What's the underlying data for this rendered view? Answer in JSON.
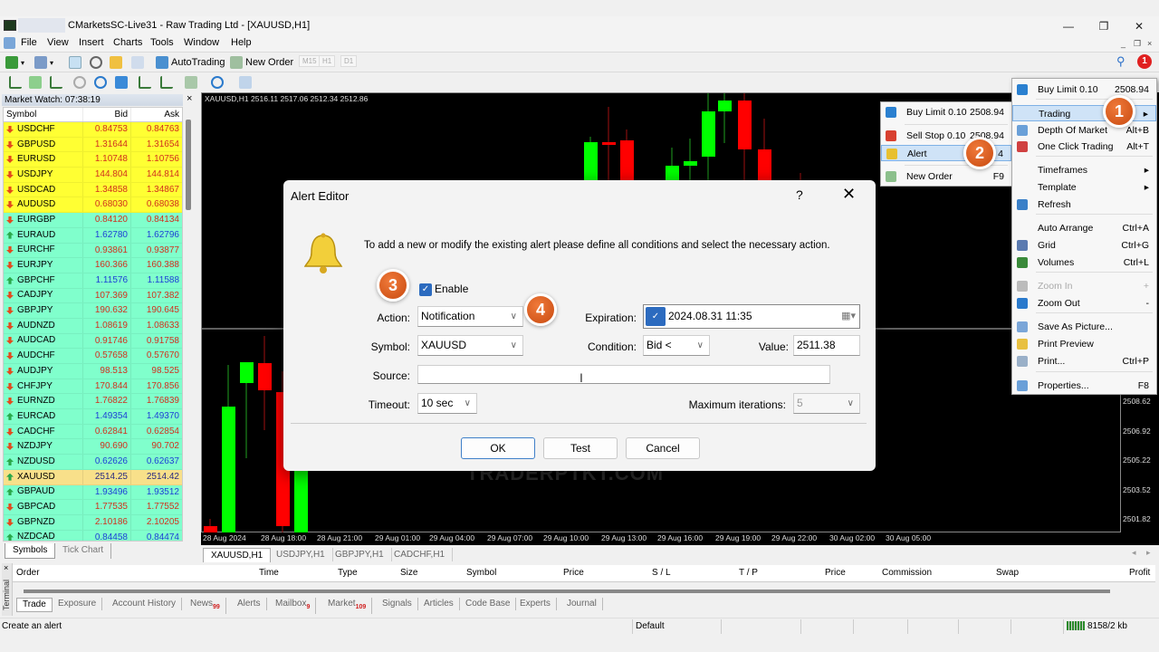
{
  "window": {
    "title": "CMarketsSC-Live31 - Raw Trading Ltd - [XAUUSD,H1]",
    "controls": {
      "minimize": "—",
      "maximize": "❐",
      "close": "✕"
    }
  },
  "menubar": {
    "items": [
      "File",
      "View",
      "Insert",
      "Charts",
      "Tools",
      "Window",
      "Help"
    ],
    "mdi": {
      "minimize": "_",
      "restore": "❐",
      "close": "×"
    }
  },
  "toolbar1": {
    "autotrading_label": "AutoTrading",
    "new_order_label": "New Order",
    "timeframes": [
      "M15",
      "H1",
      "D1"
    ],
    "notification_count": "1"
  },
  "market_watch": {
    "title": "Market Watch: 07:38:19",
    "close": "×",
    "columns": [
      "Symbol",
      "Bid",
      "Ask"
    ],
    "rows": [
      {
        "symbol": "USDCHF",
        "bid": "0.84753",
        "ask": "0.84763",
        "dir": "down",
        "bg": "yellow"
      },
      {
        "symbol": "GBPUSD",
        "bid": "1.31644",
        "ask": "1.31654",
        "dir": "down",
        "bg": "yellow"
      },
      {
        "symbol": "EURUSD",
        "bid": "1.10748",
        "ask": "1.10756",
        "dir": "down",
        "bg": "yellow"
      },
      {
        "symbol": "USDJPY",
        "bid": "144.804",
        "ask": "144.814",
        "dir": "down",
        "bg": "yellow"
      },
      {
        "symbol": "USDCAD",
        "bid": "1.34858",
        "ask": "1.34867",
        "dir": "down",
        "bg": "yellow"
      },
      {
        "symbol": "AUDUSD",
        "bid": "0.68030",
        "ask": "0.68038",
        "dir": "down",
        "bg": "yellow"
      },
      {
        "symbol": "EURGBP",
        "bid": "0.84120",
        "ask": "0.84134",
        "dir": "down",
        "bg": "teal"
      },
      {
        "symbol": "EURAUD",
        "bid": "1.62780",
        "ask": "1.62796",
        "dir": "up",
        "bg": "teal"
      },
      {
        "symbol": "EURCHF",
        "bid": "0.93861",
        "ask": "0.93877",
        "dir": "down",
        "bg": "teal"
      },
      {
        "symbol": "EURJPY",
        "bid": "160.366",
        "ask": "160.388",
        "dir": "down",
        "bg": "teal"
      },
      {
        "symbol": "GBPCHF",
        "bid": "1.11576",
        "ask": "1.11588",
        "dir": "up",
        "bg": "teal"
      },
      {
        "symbol": "CADJPY",
        "bid": "107.369",
        "ask": "107.382",
        "dir": "down",
        "bg": "teal"
      },
      {
        "symbol": "GBPJPY",
        "bid": "190.632",
        "ask": "190.645",
        "dir": "down",
        "bg": "teal"
      },
      {
        "symbol": "AUDNZD",
        "bid": "1.08619",
        "ask": "1.08633",
        "dir": "down",
        "bg": "teal"
      },
      {
        "symbol": "AUDCAD",
        "bid": "0.91746",
        "ask": "0.91758",
        "dir": "down",
        "bg": "teal"
      },
      {
        "symbol": "AUDCHF",
        "bid": "0.57658",
        "ask": "0.57670",
        "dir": "down",
        "bg": "teal"
      },
      {
        "symbol": "AUDJPY",
        "bid": "98.513",
        "ask": "98.525",
        "dir": "down",
        "bg": "teal"
      },
      {
        "symbol": "CHFJPY",
        "bid": "170.844",
        "ask": "170.856",
        "dir": "down",
        "bg": "teal"
      },
      {
        "symbol": "EURNZD",
        "bid": "1.76822",
        "ask": "1.76839",
        "dir": "down",
        "bg": "teal"
      },
      {
        "symbol": "EURCAD",
        "bid": "1.49354",
        "ask": "1.49370",
        "dir": "up",
        "bg": "teal"
      },
      {
        "symbol": "CADCHF",
        "bid": "0.62841",
        "ask": "0.62854",
        "dir": "down",
        "bg": "teal"
      },
      {
        "symbol": "NZDJPY",
        "bid": "90.690",
        "ask": "90.702",
        "dir": "down",
        "bg": "teal"
      },
      {
        "symbol": "NZDUSD",
        "bid": "0.62626",
        "ask": "0.62637",
        "dir": "up",
        "bg": "teal"
      },
      {
        "symbol": "XAUUSD",
        "bid": "2514.25",
        "ask": "2514.42",
        "dir": "up",
        "bg": "selected"
      },
      {
        "symbol": "GBPAUD",
        "bid": "1.93496",
        "ask": "1.93512",
        "dir": "up",
        "bg": "teal"
      },
      {
        "symbol": "GBPCAD",
        "bid": "1.77535",
        "ask": "1.77552",
        "dir": "down",
        "bg": "teal"
      },
      {
        "symbol": "GBPNZD",
        "bid": "2.10186",
        "ask": "2.10205",
        "dir": "down",
        "bg": "teal"
      },
      {
        "symbol": "NZDCAD",
        "bid": "0.84458",
        "ask": "0.84474",
        "dir": "up",
        "bg": "teal"
      }
    ],
    "tabs": [
      "Symbols",
      "Tick Chart"
    ]
  },
  "chart": {
    "header": "XAUUSD,H1  2516.11 2517.06 2512.34 2512.86",
    "time_labels": [
      "28 Aug 2024",
      "28 Aug 18:00",
      "28 Aug 21:00",
      "29 Aug 01:00",
      "29 Aug 04:00",
      "29 Aug 07:00",
      "29 Aug 10:00",
      "29 Aug 13:00",
      "29 Aug 16:00",
      "29 Aug 19:00",
      "29 Aug 22:00",
      "30 Aug 02:00",
      "30 Aug 05:00"
    ],
    "price_labels": [
      "2508.62",
      "2506.92",
      "2505.22",
      "2503.52",
      "2501.82"
    ],
    "watermark": "TRADERPTKT.COM",
    "tabs": [
      "XAUUSD,H1",
      "USDJPY,H1",
      "GBPJPY,H1",
      "CADCHF,H1"
    ]
  },
  "alert_dialog": {
    "title": "Alert Editor",
    "help": "?",
    "close": "✕",
    "description": "To add a new or modify the existing alert please define all conditions and select the necessary action.",
    "enable_label": "Enable",
    "enable_checked": true,
    "action_label": "Action:",
    "action_value": "Notification",
    "expiration_label": "Expiration:",
    "expiration_value": "2024.08.31 11:35",
    "expiration_checked": true,
    "symbol_label": "Symbol:",
    "symbol_value": "XAUUSD",
    "condition_label": "Condition:",
    "condition_value": "Bid <",
    "value_label": "Value:",
    "value_value": "2511.38",
    "source_label": "Source:",
    "source_value": "",
    "timeout_label": "Timeout:",
    "timeout_value": "10 sec",
    "max_iter_label": "Maximum iterations:",
    "max_iter_value": "5",
    "ok_label": "OK",
    "test_label": "Test",
    "cancel_label": "Cancel"
  },
  "submenu": {
    "items": [
      {
        "label": "Buy Limit 0.10",
        "shortcut": "2508.94"
      },
      {
        "label": "Sell Stop 0.10",
        "shortcut": "2508.94"
      },
      {
        "label": "Alert",
        "shortcut": "4"
      },
      {
        "label": "New Order",
        "shortcut": "F9"
      }
    ]
  },
  "context_menu": {
    "items": [
      {
        "label": "Buy Limit 0.10",
        "shortcut": "2508.94"
      },
      {
        "label": "Trading",
        "shortcut": "▸"
      },
      {
        "label": "Depth Of Market",
        "shortcut": "Alt+B"
      },
      {
        "label": "One Click Trading",
        "shortcut": "Alt+T"
      },
      {
        "label": "Timeframes",
        "shortcut": "▸"
      },
      {
        "label": "Template",
        "shortcut": "▸"
      },
      {
        "label": "Refresh",
        "shortcut": ""
      },
      {
        "label": "Auto Arrange",
        "shortcut": "Ctrl+A"
      },
      {
        "label": "Grid",
        "shortcut": "Ctrl+G"
      },
      {
        "label": "Volumes",
        "shortcut": "Ctrl+L"
      },
      {
        "label": "Zoom In",
        "shortcut": "+"
      },
      {
        "label": "Zoom Out",
        "shortcut": "-"
      },
      {
        "label": "Save As Picture...",
        "shortcut": ""
      },
      {
        "label": "Print Preview",
        "shortcut": ""
      },
      {
        "label": "Print...",
        "shortcut": "Ctrl+P"
      },
      {
        "label": "Properties...",
        "shortcut": "F8"
      }
    ]
  },
  "step_badges": [
    "1",
    "2",
    "3",
    "4"
  ],
  "terminal": {
    "side_label": "Terminal",
    "close": "×",
    "columns": [
      "Order",
      "Time",
      "Type",
      "Size",
      "Symbol",
      "Price",
      "S / L",
      "T / P",
      "Price",
      "Commission",
      "Swap",
      "Profit"
    ],
    "tabs": [
      {
        "label": "Trade",
        "count": ""
      },
      {
        "label": "Exposure",
        "count": ""
      },
      {
        "label": "Account History",
        "count": ""
      },
      {
        "label": "News",
        "count": "99"
      },
      {
        "label": "Alerts",
        "count": ""
      },
      {
        "label": "Mailbox",
        "count": "9"
      },
      {
        "label": "Market",
        "count": "109"
      },
      {
        "label": "Signals",
        "count": ""
      },
      {
        "label": "Articles",
        "count": ""
      },
      {
        "label": "Code Base",
        "count": ""
      },
      {
        "label": "Experts",
        "count": ""
      },
      {
        "label": "Journal",
        "count": ""
      }
    ]
  },
  "status_bar": {
    "message": "Create an alert",
    "profile": "Default",
    "traffic": "8158/2 kb"
  }
}
